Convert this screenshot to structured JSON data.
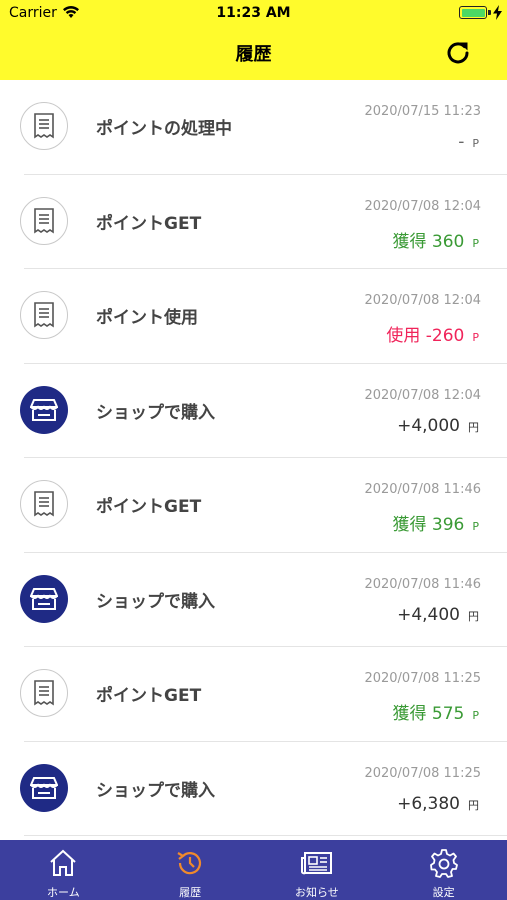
{
  "status_bar": {
    "carrier": "Carrier",
    "time": "11:23 AM"
  },
  "header": {
    "title": "履歴",
    "refresh_icon": "refresh-icon"
  },
  "colors": {
    "header_bg": "#fffb2c",
    "tab_bg": "#3c3f9e",
    "get": "#3a9a35",
    "use": "#f0245a",
    "shop_icon_bg": "#1f2a85",
    "active_tab": "#f08a2c"
  },
  "history": [
    {
      "type": "receipt",
      "label": "ポイントの処理中",
      "date": "2020/07/15 11:23",
      "amount": "-",
      "unit": "P",
      "kind": "pending"
    },
    {
      "type": "receipt",
      "label": "ポイントGET",
      "date": "2020/07/08 12:04",
      "amount": "獲得 360",
      "unit": "P",
      "kind": "get"
    },
    {
      "type": "receipt",
      "label": "ポイント使用",
      "date": "2020/07/08 12:04",
      "amount": "使用 -260",
      "unit": "P",
      "kind": "use"
    },
    {
      "type": "shop",
      "label": "ショップで購入",
      "date": "2020/07/08 12:04",
      "amount": "+4,000",
      "unit": "円",
      "kind": "shop"
    },
    {
      "type": "receipt",
      "label": "ポイントGET",
      "date": "2020/07/08 11:46",
      "amount": "獲得 396",
      "unit": "P",
      "kind": "get"
    },
    {
      "type": "shop",
      "label": "ショップで購入",
      "date": "2020/07/08 11:46",
      "amount": "+4,400",
      "unit": "円",
      "kind": "shop"
    },
    {
      "type": "receipt",
      "label": "ポイントGET",
      "date": "2020/07/08 11:25",
      "amount": "獲得 575",
      "unit": "P",
      "kind": "get"
    },
    {
      "type": "shop",
      "label": "ショップで購入",
      "date": "2020/07/08 11:25",
      "amount": "+6,380",
      "unit": "円",
      "kind": "shop"
    }
  ],
  "tabs": [
    {
      "label": "ホーム",
      "icon": "home-icon",
      "active": false
    },
    {
      "label": "履歴",
      "icon": "history-icon",
      "active": true
    },
    {
      "label": "お知らせ",
      "icon": "news-icon",
      "active": false
    },
    {
      "label": "設定",
      "icon": "settings-icon",
      "active": false
    }
  ]
}
